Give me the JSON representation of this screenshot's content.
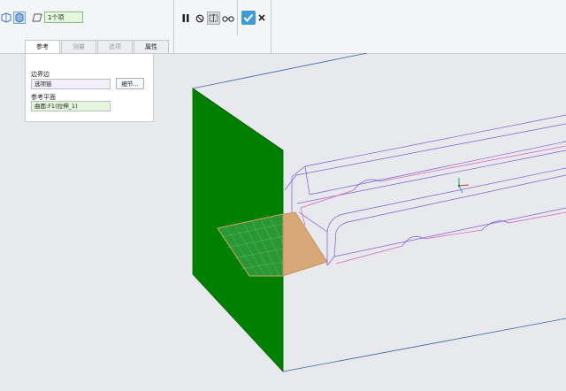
{
  "ribbon": {
    "selection_count": "1个项",
    "icons": [
      "surface-icon",
      "solid-icon",
      "plane-icon",
      "pause-icon",
      "stop-icon",
      "preview-icon",
      "glasses-icon",
      "confirm-icon",
      "cancel-icon"
    ]
  },
  "tabs": [
    {
      "label": "参考",
      "state": "active"
    },
    {
      "label": "测量",
      "state": "disabled"
    },
    {
      "label": "选项",
      "state": "disabled"
    },
    {
      "label": "属性",
      "state": "normal"
    }
  ],
  "panel": {
    "boundary_label": "边界边",
    "boundary_value": "选项链",
    "details_button": "细节...",
    "ref_plane_label": "参考平面",
    "ref_plane_value": "曲面:F1(拉伸_1)"
  },
  "colors": {
    "green_face": "#008000",
    "orange_sketch": "#d9a878",
    "select_green": "#e4f6dc",
    "select_purple": "#f3eefa",
    "confirm_blue": "#3f9bd8",
    "edge_blue": "#3466a8",
    "wire_purple": "#7a5ad9",
    "wire_pink": "#e05ab6"
  }
}
